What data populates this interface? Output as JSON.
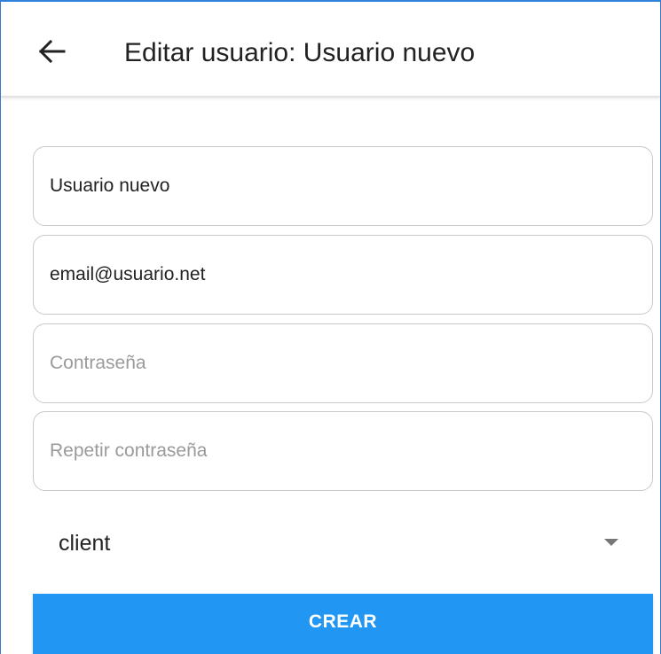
{
  "header": {
    "title": "Editar usuario: Usuario nuevo",
    "back_icon": "arrow-left-icon"
  },
  "form": {
    "name": {
      "value": "Usuario nuevo",
      "placeholder": ""
    },
    "email": {
      "value": "email@usuario.net",
      "placeholder": ""
    },
    "password": {
      "value": "",
      "placeholder": "Contraseña"
    },
    "password_repeat": {
      "value": "",
      "placeholder": "Repetir contraseña"
    },
    "role": {
      "selected": "client",
      "caret_icon": "dropdown-caret-icon"
    },
    "submit_label": "CREAR"
  },
  "colors": {
    "primary": "#2196f3",
    "text": "#222222",
    "placeholder": "#9a9a9a",
    "border": "#c9c9c9"
  }
}
